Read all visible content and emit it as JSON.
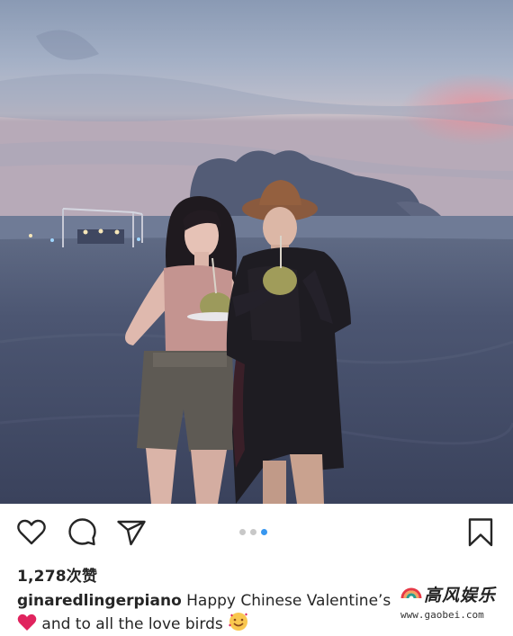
{
  "post": {
    "likes_text": "1,278次赞",
    "username": "ginaredlingerpiano",
    "caption_line1": " Happy Chinese Valentine’s ",
    "caption_line2": " and to all the love birds ",
    "carousel_active_index": 2,
    "carousel_count": 3
  },
  "actions": {
    "like_icon": "heart-outline-icon",
    "comment_icon": "comment-bubble-icon",
    "share_icon": "paper-plane-icon",
    "save_icon": "bookmark-icon"
  },
  "watermark": {
    "title": "高风娱乐",
    "url": "www.gaobei.com"
  },
  "colors": {
    "text": "#262626",
    "dot_active": "#3897f0",
    "dot_inactive": "#c8c8c8",
    "heart_emoji": "#e0245e"
  }
}
